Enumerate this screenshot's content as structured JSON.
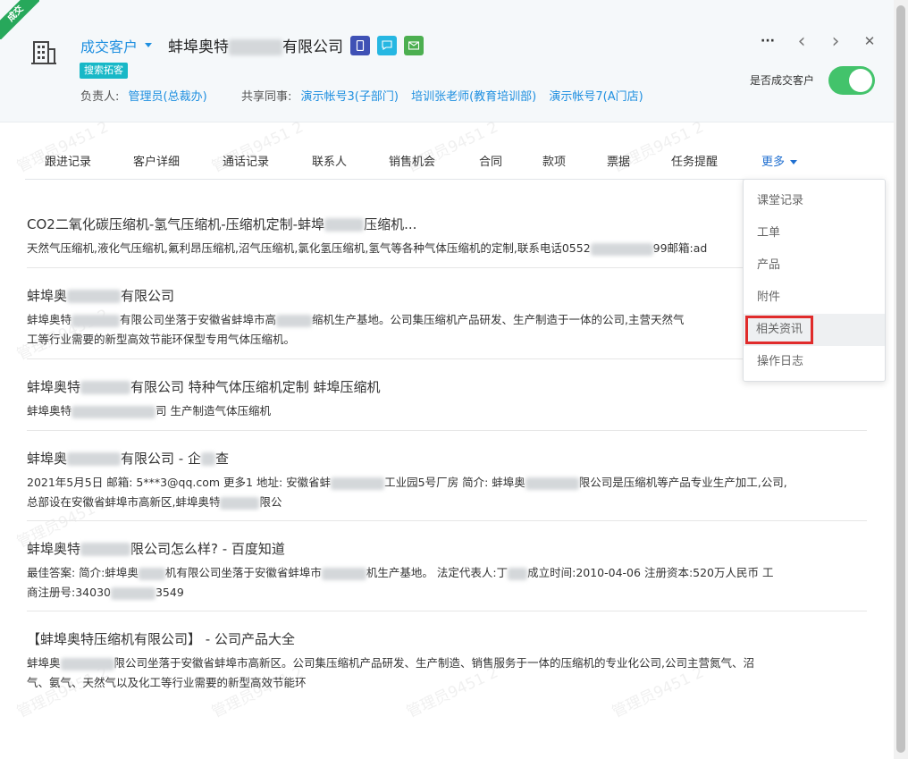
{
  "ribbon": "成交",
  "header": {
    "status": "成交客户",
    "company_prefix": "蚌埠奥特",
    "company_suffix": "有限公司",
    "tag": "搜索拓客",
    "owner_label": "负责人:",
    "owner": "管理员(总裁办)",
    "shared_label": "共享同事:",
    "shared": [
      "演示帐号3(子部门)",
      "培训张老师(教育培训部)",
      "演示帐号7(A门店)"
    ],
    "toggle_label": "是否成交客户",
    "toggle_on": true
  },
  "top_actions": {
    "more": "···",
    "prev": "‹",
    "next": "›",
    "close": "✕"
  },
  "watermark": "管理员9451 2",
  "tabs": [
    "跟进记录",
    "客户详细",
    "通话记录",
    "联系人",
    "销售机会",
    "合同",
    "款项",
    "票据",
    "任务提醒",
    "更多"
  ],
  "dropdown": [
    "课堂记录",
    "工单",
    "产品",
    "附件",
    "相关资讯",
    "操作日志"
  ],
  "results": [
    {
      "t1": "CO2二氧化碳压缩机-氢气压缩机-压缩机定制-蚌埠",
      "t2": "压缩机...",
      "lines": [
        [
          "天然气压缩机,液化气压缩机,氟利昂压缩机,沼气压缩机,氯化氢压缩机,氢气等各种气体压缩机的定制,联系电话0552",
          "99邮箱:ad"
        ]
      ]
    },
    {
      "t1": "蚌埠奥",
      "t2": "有限公司",
      "lines": [
        [
          "蚌埠奥特",
          "有限公司坐落于安徽省蚌埠市高",
          "缩机生产基地。公司集压缩机产品研发、生产制造于一体的公司,主营天然气"
        ],
        [
          "工等行业需要的新型高效节能环保型专用气体压缩机。"
        ]
      ]
    },
    {
      "t1": "蚌埠奥特",
      "t2": "有限公司 特种气体压缩机定制 蚌埠压缩机",
      "lines": [
        [
          "蚌埠奥特",
          "司 生产制造气体压缩机"
        ]
      ]
    },
    {
      "t1": "蚌埠奥",
      "t2": "有限公司 - 企",
      "t3": "查",
      "lines": [
        [
          "2021年5月5日 邮箱: 5***3@qq.com 更多1 地址: 安徽省蚌",
          "工业园5号厂房 简介: 蚌埠奥",
          "限公司是压缩机等产品专业生产加工,公司,"
        ],
        [
          "总部设在安徽省蚌埠市高新区,蚌埠奥特",
          "限公"
        ]
      ]
    },
    {
      "t1": "蚌埠奥特",
      "t2": "限公司怎么样? - 百度知道",
      "lines": [
        [
          "最佳答案: 简介:蚌埠奥",
          "机有限公司坐落于安徽省蚌埠市",
          "机生产基地。 法定代表人:丁",
          "成立时间:2010-04-06 注册资本:520万人民币 工"
        ],
        [
          "商注册号:34030",
          "3549"
        ]
      ]
    },
    {
      "t1": "【蚌埠奥特压缩机有限公司】 - 公司产品大全",
      "lines": [
        [
          "蚌埠奥",
          "限公司坐落于安徽省蚌埠市高新区。公司集压缩机产品研发、生产制造、销售服务于一体的压缩机的专业化公司,公司主营氮气、沼"
        ],
        [
          "气、氨气、天然气以及化工等行业需要的新型高效节能环"
        ]
      ]
    }
  ]
}
